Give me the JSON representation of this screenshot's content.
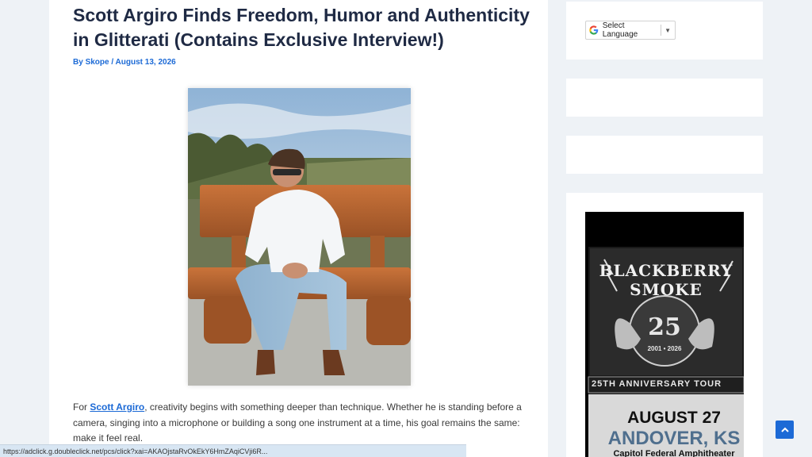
{
  "article": {
    "title": "Scott Argiro Finds Freedom, Humor and Authenticity in Glitterati (Contains Exclusive Interview!)",
    "by_prefix": "By ",
    "author": "Skope",
    "separator": " / ",
    "date": "August 13, 2026",
    "body_prefix": "For ",
    "body_link": "Scott Argiro",
    "body_rest": ", creativity begins with something deeper than technique. Whether he is standing before a camera, singing into a microphone or building a song one instrument at a time, his goal remains the same: make it feel real."
  },
  "sidebar": {
    "language_label": "Select Language",
    "language_arrow": "▼"
  },
  "ad": {
    "band": "BLACKBERRY SMOKE",
    "anniversary_number": "25",
    "years": "2001 • 2026",
    "tour": "25TH ANNIVERSARY TOUR",
    "date": "AUGUST 27",
    "city": "ANDOVER, KS",
    "venue": "Capitol Federal Amphitheater"
  },
  "status_bar": {
    "url": "https://adclick.g.doubleclick.net/pcs/click?xai=AKAOjstaRvOkEkY6HmZAqiCVji6R..."
  },
  "colors": {
    "accent": "#1c6ad6",
    "title": "#1f2a44",
    "page_bg": "#eef2f6"
  }
}
